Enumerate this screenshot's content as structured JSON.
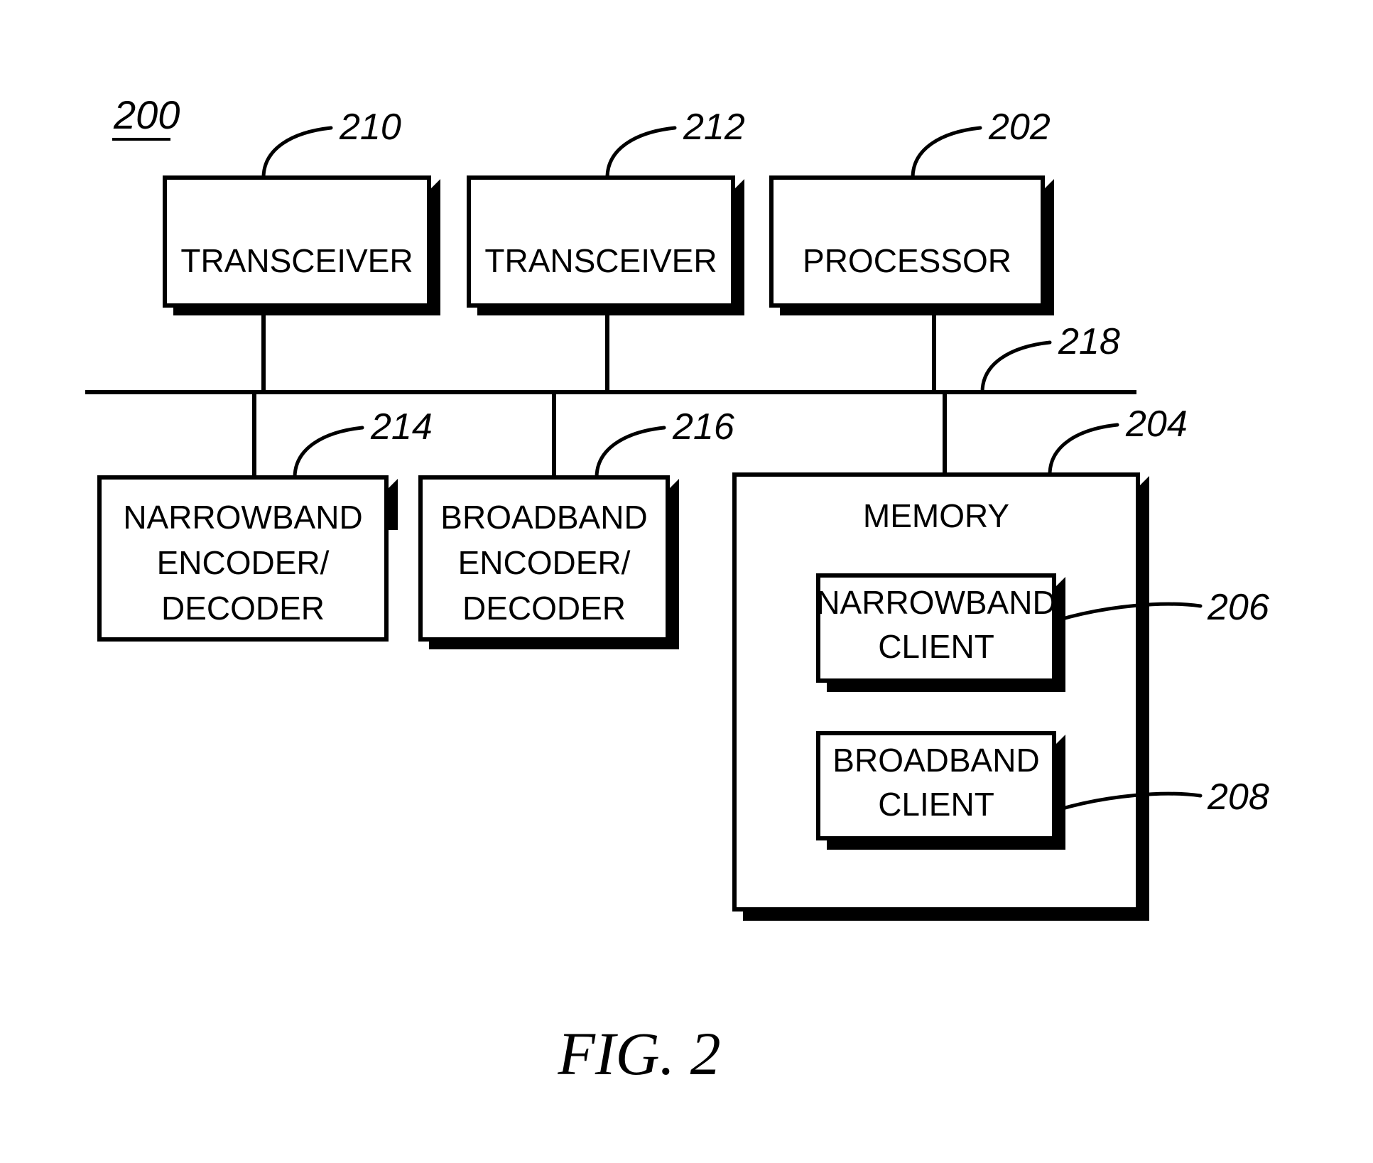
{
  "figure": {
    "caption": "FIG. 2",
    "figure_number": "200"
  },
  "blocks": {
    "transceiver_1": {
      "label": "TRANSCEIVER",
      "ref": "210"
    },
    "transceiver_2": {
      "label": "TRANSCEIVER",
      "ref": "212"
    },
    "processor": {
      "label": "PROCESSOR",
      "ref": "202"
    },
    "narrowband_codec": {
      "line1": "NARROWBAND",
      "line2": "ENCODER/",
      "line3": "DECODER",
      "ref": "214"
    },
    "broadband_codec": {
      "line1": "BROADBAND",
      "line2": "ENCODER/",
      "line3": "DECODER",
      "ref": "216"
    },
    "memory": {
      "label": "MEMORY",
      "ref": "204"
    },
    "narrowband_client": {
      "line1": "NARROWBAND",
      "line2": "CLIENT",
      "ref": "206"
    },
    "broadband_client": {
      "line1": "BROADBAND",
      "line2": "CLIENT",
      "ref": "208"
    },
    "bus": {
      "ref": "218"
    }
  },
  "colors": {
    "ink": "#000000",
    "paper": "#ffffff"
  }
}
